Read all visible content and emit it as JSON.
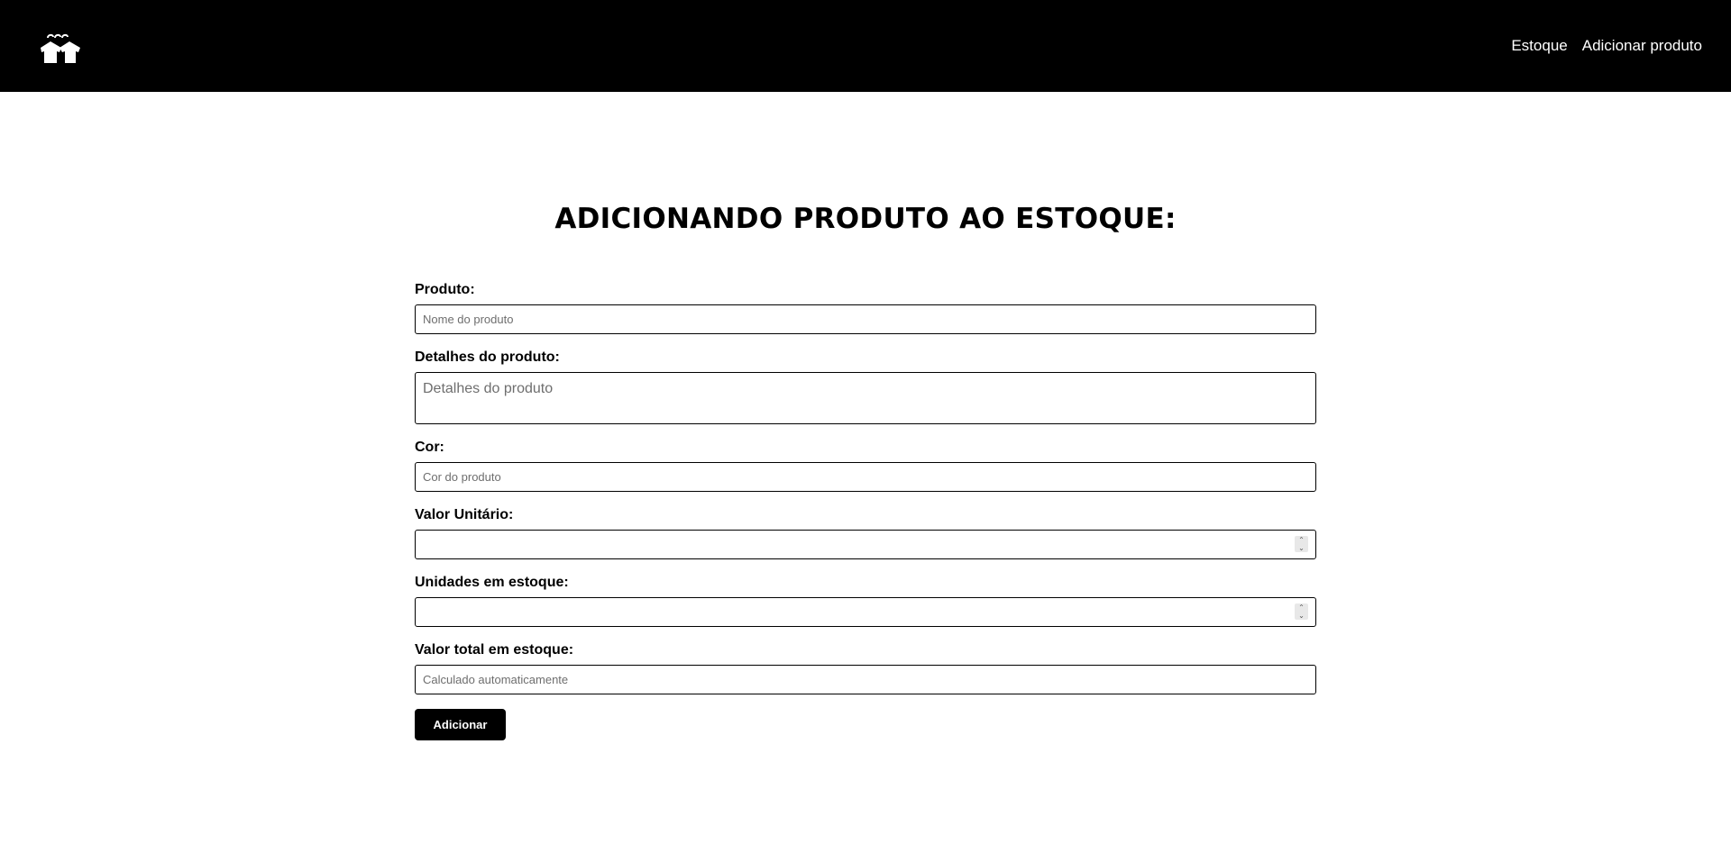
{
  "header": {
    "logo_icon": "hanging-shirts-logo-icon",
    "nav": [
      {
        "label": "Estoque"
      },
      {
        "label": "Adicionar produto"
      }
    ]
  },
  "main": {
    "title": "ADICIONANDO PRODUTO AO ESTOQUE:",
    "form": {
      "produto": {
        "label": "Produto:",
        "placeholder": "Nome do produto",
        "value": ""
      },
      "detalhes": {
        "label": "Detalhes do produto:",
        "placeholder": "Detalhes do produto",
        "value": ""
      },
      "cor": {
        "label": "Cor:",
        "placeholder": "Cor do produto",
        "value": ""
      },
      "valor_unitario": {
        "label": "Valor Unitário:",
        "placeholder": "",
        "value": ""
      },
      "unidades": {
        "label": "Unidades em estoque:",
        "placeholder": "",
        "value": ""
      },
      "valor_total": {
        "label": "Valor total em estoque:",
        "placeholder": "Calculado automaticamente",
        "value": ""
      },
      "submit_label": "Adicionar"
    }
  },
  "colors": {
    "header_bg": "#000000",
    "button_bg": "#000000",
    "text": "#000000",
    "placeholder": "#6e6e6e"
  }
}
